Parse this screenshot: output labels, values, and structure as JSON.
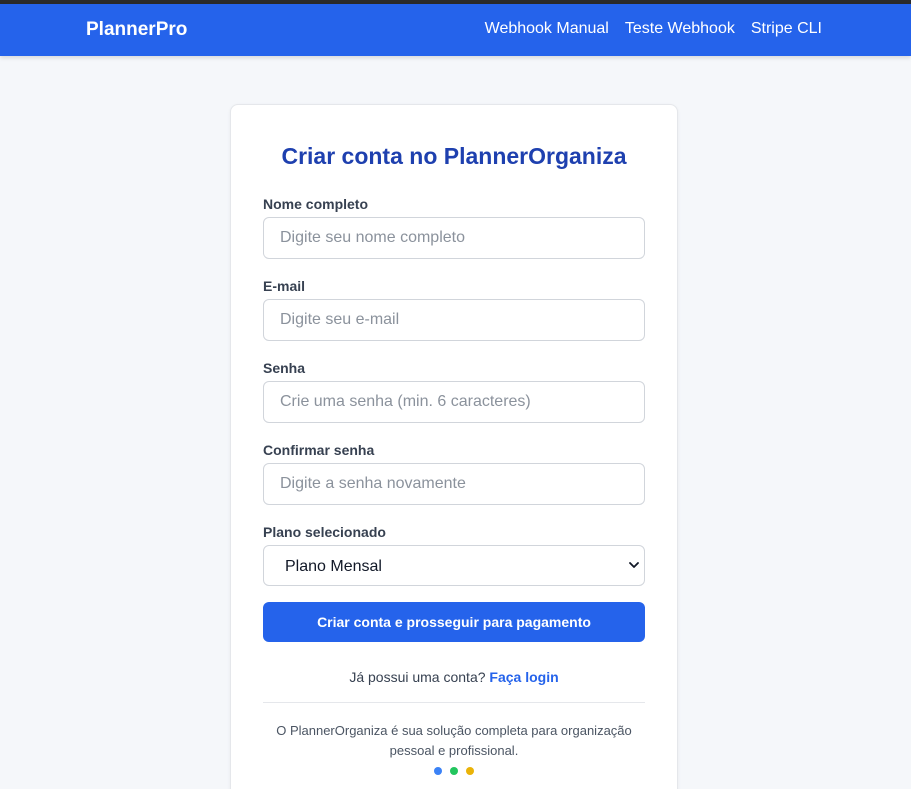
{
  "navbar": {
    "brand": "PlannerPro",
    "links": [
      "Webhook Manual",
      "Teste Webhook",
      "Stripe CLI"
    ]
  },
  "form": {
    "title": "Criar conta no PlannerOrganiza",
    "name": {
      "label": "Nome completo",
      "placeholder": "Digite seu nome completo",
      "value": ""
    },
    "email": {
      "label": "E-mail",
      "placeholder": "Digite seu e-mail",
      "value": ""
    },
    "password": {
      "label": "Senha",
      "placeholder": "Crie uma senha (min. 6 caracteres)",
      "value": ""
    },
    "confirm": {
      "label": "Confirmar senha",
      "placeholder": "Digite a senha novamente",
      "value": ""
    },
    "plan": {
      "label": "Plano selecionado",
      "selected": "Plano Mensal"
    },
    "submit_label": "Criar conta e prosseguir para pagamento",
    "login_prompt": "Já possui uma conta?",
    "login_link": "Faça login",
    "footer": "O PlannerOrganiza é sua solução completa para organização pessoal e profissional."
  },
  "colors": {
    "primary": "#2563eb",
    "title": "#1e40af",
    "dots": [
      "#3b82f6",
      "#22c55e",
      "#eab308"
    ]
  }
}
